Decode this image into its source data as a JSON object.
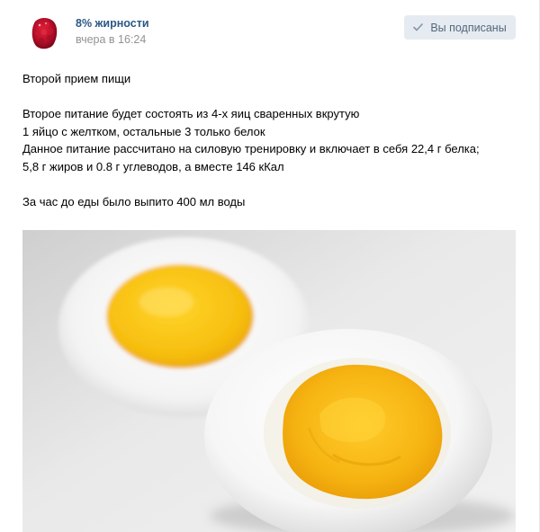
{
  "post": {
    "author": "8% жирности",
    "date": "вчера в 16:24",
    "subscribe_label": "Вы подписаны",
    "text_lines": [
      "Второй прием пищи",
      "",
      "Второе питание будет состоять из 4-х яиц сваренных вкрутую",
      "1 яйцо с желтком, остальные 3 только белок",
      "Данное питание рассчитано на силовую тренировку и включает в себя 22,4 г белка;",
      "5,8 г жиров и 0.8 г углеводов, а вместе 146 кКал",
      "",
      "За час до еды было выпито 400 мл воды"
    ]
  },
  "icons": {
    "avatar": "raspberry-avatar",
    "subscribe": "checkmark-icon"
  },
  "colors": {
    "link": "#2a5885",
    "muted": "#939393",
    "button_bg": "#e5ebf1",
    "button_text": "#55677d"
  }
}
